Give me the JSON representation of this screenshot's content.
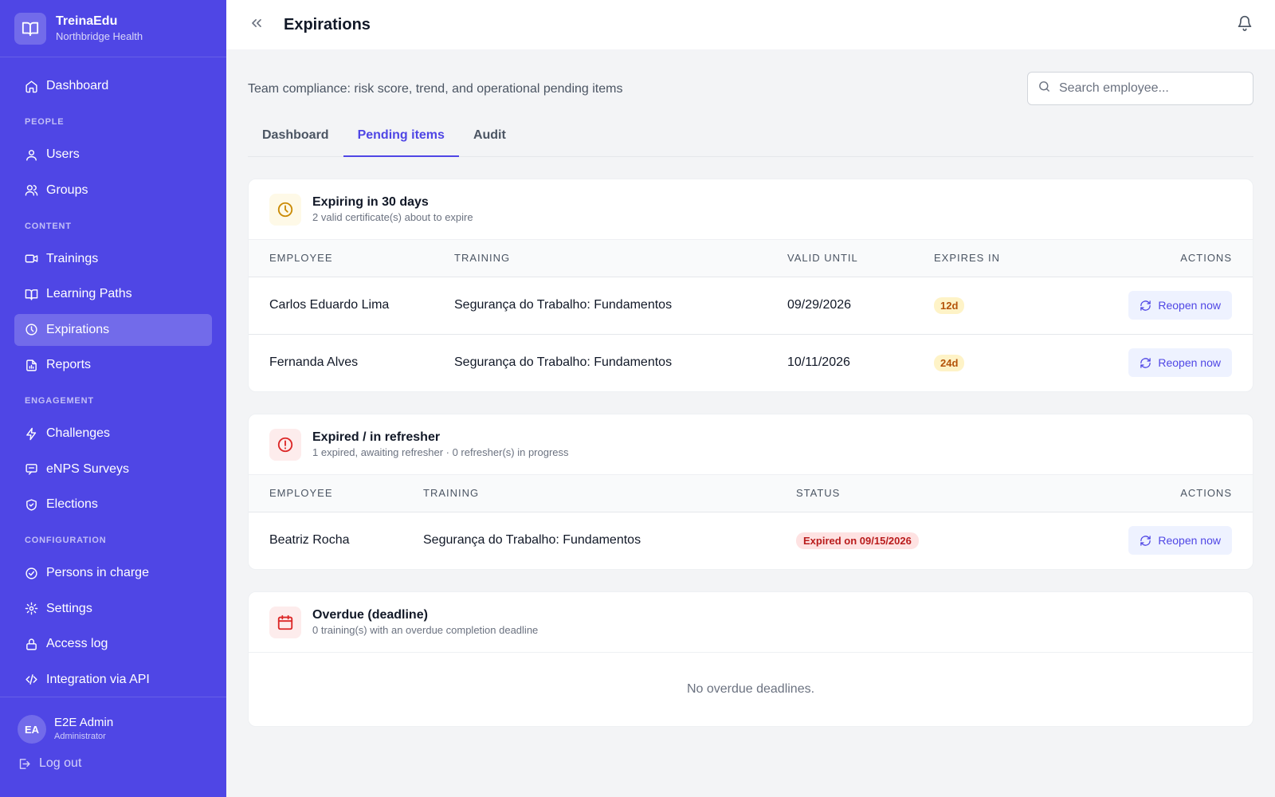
{
  "brand": {
    "name": "TreinaEdu",
    "org": "Northbridge Health"
  },
  "nav": {
    "dashboard": "Dashboard",
    "section_people": "PEOPLE",
    "users": "Users",
    "groups": "Groups",
    "section_content": "CONTENT",
    "trainings": "Trainings",
    "learning_paths": "Learning Paths",
    "expirations": "Expirations",
    "reports": "Reports",
    "section_engagement": "ENGAGEMENT",
    "challenges": "Challenges",
    "enps": "eNPS Surveys",
    "elections": "Elections",
    "section_configuration": "CONFIGURATION",
    "persons_in_charge": "Persons in charge",
    "settings": "Settings",
    "access_log": "Access log",
    "integration": "Integration via API"
  },
  "user": {
    "initials": "EA",
    "name": "E2E Admin",
    "role": "Administrator",
    "logout": "Log out"
  },
  "header": {
    "title": "Expirations"
  },
  "intro": "Team compliance: risk score, trend, and operational pending items",
  "search": {
    "placeholder": "Search employee..."
  },
  "tabs": [
    "Dashboard",
    "Pending items",
    "Audit"
  ],
  "expiring": {
    "title": "Expiring in 30 days",
    "subtitle": "2 valid certificate(s) about to expire",
    "columns": [
      "EMPLOYEE",
      "TRAINING",
      "VALID UNTIL",
      "EXPIRES IN",
      "ACTIONS"
    ],
    "rows": [
      {
        "employee": "Carlos Eduardo Lima",
        "training": "Segurança do Trabalho: Fundamentos",
        "valid_until": "09/29/2026",
        "expires_in": "12d",
        "action": "Reopen now"
      },
      {
        "employee": "Fernanda Alves",
        "training": "Segurança do Trabalho: Fundamentos",
        "valid_until": "10/11/2026",
        "expires_in": "24d",
        "action": "Reopen now"
      }
    ]
  },
  "expired": {
    "title": "Expired / in refresher",
    "subtitle": "1 expired, awaiting refresher · 0 refresher(s) in progress",
    "columns": [
      "EMPLOYEE",
      "TRAINING",
      "STATUS",
      "ACTIONS"
    ],
    "rows": [
      {
        "employee": "Beatriz Rocha",
        "training": "Segurança do Trabalho: Fundamentos",
        "status": "Expired on 09/15/2026",
        "action": "Reopen now"
      }
    ]
  },
  "overdue": {
    "title": "Overdue (deadline)",
    "subtitle": "0 training(s) with an overdue completion deadline",
    "empty": "No overdue deadlines."
  },
  "colors": {
    "accent": "#4f46e5",
    "warn_bg": "#fef3c7",
    "warn_fg": "#b45309",
    "error_bg": "#fee2e2",
    "error_fg": "#b91c1c"
  },
  "icons": {
    "brand": "book-open-icon",
    "dashboard": "home-icon",
    "users": "user-icon",
    "groups": "users-icon",
    "trainings": "video-icon",
    "learning_paths": "map-icon",
    "expirations": "clock-icon",
    "reports": "file-icon",
    "challenges": "zap-icon",
    "enps": "message-icon",
    "elections": "shield-icon",
    "persons_in_charge": "check-circle-icon",
    "settings": "gear-icon",
    "access_log": "lock-icon",
    "integration": "code-icon",
    "logout": "logout-icon",
    "collapse": "chevrons-left-icon",
    "notifications": "bell-icon",
    "search": "search-icon",
    "reopen": "refresh-icon",
    "expiring": "clock-icon",
    "expired": "alert-circle-icon",
    "overdue": "calendar-icon"
  }
}
